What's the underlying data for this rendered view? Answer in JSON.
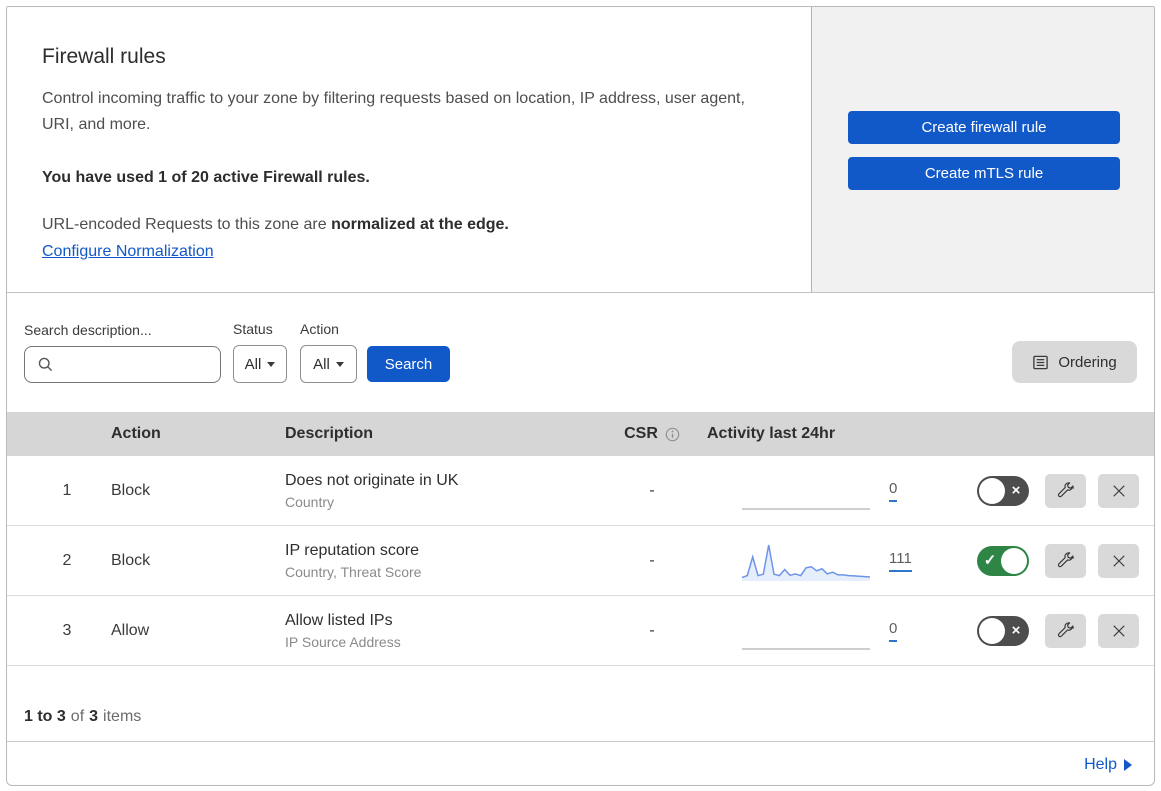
{
  "page": {
    "title": "Firewall rules",
    "description": "Control incoming traffic to your zone by filtering requests based on location, IP address, user agent, URI, and more.",
    "usage_bold": "You have used 1 of 20 active Firewall rules.",
    "normalization_text": "URL-encoded Requests to this zone are ",
    "normalization_bold": "normalized at the edge.",
    "normalization_link": "Configure Normalization"
  },
  "actions_panel": {
    "create_firewall_label": "Create firewall rule",
    "create_mtls_label": "Create mTLS rule"
  },
  "filters": {
    "search_label": "Search description...",
    "status_label": "Status",
    "status_value": "All",
    "action_label": "Action",
    "action_value": "All",
    "search_button_label": "Search",
    "ordering_label": "Ordering"
  },
  "table": {
    "headers": {
      "action": "Action",
      "description": "Description",
      "csr": "CSR",
      "activity": "Activity last 24hr"
    },
    "rows": [
      {
        "priority": "1",
        "action": "Block",
        "description": "Does not originate in UK",
        "fields": "Country",
        "csr": "-",
        "activity_count": "0",
        "enabled": false,
        "sparkline": []
      },
      {
        "priority": "2",
        "action": "Block",
        "description": "IP reputation score",
        "fields": "Country, Threat Score",
        "csr": "-",
        "activity_count": "111",
        "enabled": true,
        "sparkline": [
          4,
          10,
          65,
          10,
          14,
          100,
          14,
          10,
          28,
          11,
          15,
          10,
          33,
          36,
          24,
          30,
          15,
          20,
          12,
          12,
          10,
          9,
          8,
          7,
          6
        ]
      },
      {
        "priority": "3",
        "action": "Allow",
        "description": "Allow listed IPs",
        "fields": "IP Source Address",
        "csr": "-",
        "activity_count": "0",
        "enabled": false,
        "sparkline": []
      }
    ]
  },
  "footer": {
    "range_bold": "1 to 3",
    "of_word": "of",
    "total_bold": "3",
    "items_word": "items",
    "help_label": "Help"
  },
  "colors": {
    "primary_blue": "#1159c8",
    "link_blue": "#1159c8",
    "toggle_on_green": "#2e8545",
    "toggle_off_gray": "#4d4d4d",
    "sparkline_blue": "#6c95e8",
    "count_underline_blue": "#2e77c8",
    "table_header_gray": "#d6d6d6",
    "panel_gray": "#f1f1f1",
    "button_gray": "#d9d9d9"
  }
}
